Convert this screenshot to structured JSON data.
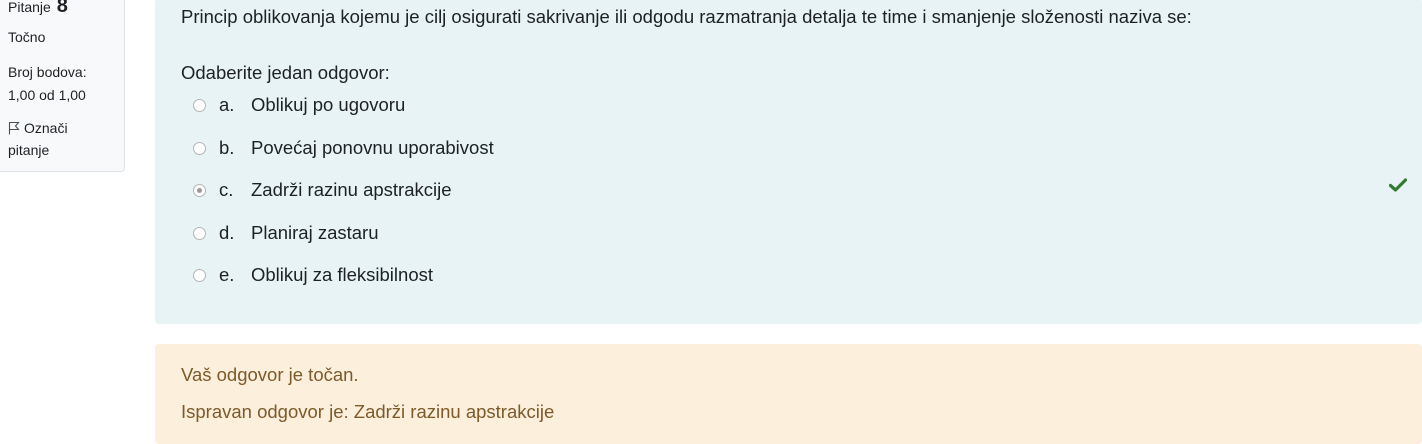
{
  "question_info": {
    "label": "Pitanje",
    "number": "8",
    "state": "Točno",
    "grade_label": "Broj bodova:",
    "grade_value": "1,00 od 1,00",
    "flag_label": "Označi pitanje"
  },
  "question": {
    "text": "Princip oblikovanja kojemu je cilj osigurati sakrivanje ili odgodu razmatranja detalja te time i smanjenje složenosti naziva se:",
    "prompt": "Odaberite jedan odgovor:",
    "options": [
      {
        "letter": "a.",
        "text": "Oblikuj po ugovoru",
        "selected": false
      },
      {
        "letter": "b.",
        "text": "Povećaj ponovnu uporabivost",
        "selected": false
      },
      {
        "letter": "c.",
        "text": "Zadrži razinu apstrakcije",
        "selected": true
      },
      {
        "letter": "d.",
        "text": "Planiraj zastaru",
        "selected": false
      },
      {
        "letter": "e.",
        "text": "Oblikuj za fleksibilnost",
        "selected": false
      }
    ],
    "correct_icon": "checkmark-icon"
  },
  "feedback": {
    "general": "Vaš odgovor je točan.",
    "right_answer": "Ispravan odgovor je: Zadrži razinu apstrakcije"
  },
  "colors": {
    "formulation_bg": "#e7f3f5",
    "feedback_bg": "#fcefdc",
    "feedback_text": "#7d5a29",
    "check_green": "#357a32"
  }
}
